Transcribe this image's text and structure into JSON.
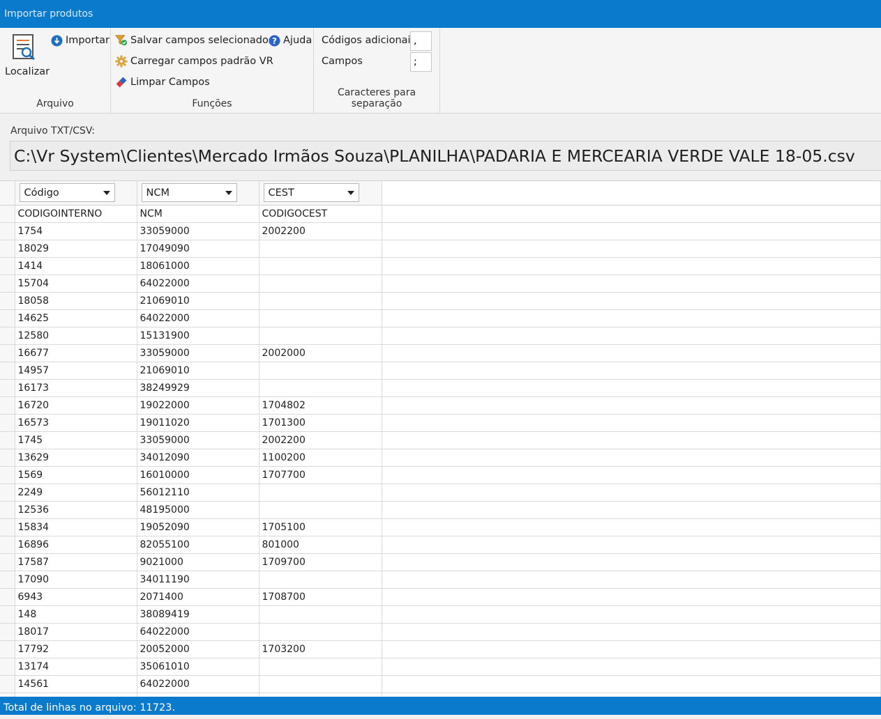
{
  "window": {
    "title": "Importar produtos"
  },
  "ribbon": {
    "arquivo": {
      "group_label": "Arquivo",
      "localizar_label": "Localizar",
      "importar_label": "Importar"
    },
    "funcoes": {
      "group_label": "Funções",
      "salvar_label": "Salvar campos selecionados",
      "ajuda_label": "Ajuda",
      "carregar_label": "Carregar campos padrão VR",
      "limpar_label": "Limpar Campos"
    },
    "separadores": {
      "group_label": "Caracteres para separação",
      "codigos_label": "Códigos adicionais",
      "codigos_value": ",",
      "campos_label": "Campos",
      "campos_value": ";"
    }
  },
  "file": {
    "label": "Arquivo TXT/CSV:",
    "path": "C:\\Vr System\\Clientes\\Mercado Irmãos Souza\\PLANILHA\\PADARIA E MERCEARIA VERDE VALE 18-05.csv"
  },
  "grid": {
    "field_selectors": [
      "Código",
      "NCM",
      "CEST"
    ],
    "rows": [
      [
        "CODIGOINTERNO",
        "NCM",
        "CODIGOCEST"
      ],
      [
        "1754",
        "33059000",
        "2002200"
      ],
      [
        "18029",
        "17049090",
        ""
      ],
      [
        "1414",
        "18061000",
        ""
      ],
      [
        "15704",
        "64022000",
        ""
      ],
      [
        "18058",
        "21069010",
        ""
      ],
      [
        "14625",
        "64022000",
        ""
      ],
      [
        "12580",
        "15131900",
        ""
      ],
      [
        "16677",
        "33059000",
        "2002000"
      ],
      [
        "14957",
        "21069010",
        ""
      ],
      [
        "16173",
        "38249929",
        ""
      ],
      [
        "16720",
        "19022000",
        "1704802"
      ],
      [
        "16573",
        "19011020",
        "1701300"
      ],
      [
        "1745",
        "33059000",
        "2002200"
      ],
      [
        "13629",
        "34012090",
        "1100200"
      ],
      [
        "1569",
        "16010000",
        "1707700"
      ],
      [
        "2249",
        "56012110",
        ""
      ],
      [
        "12536",
        "48195000",
        ""
      ],
      [
        "15834",
        "19052090",
        "1705100"
      ],
      [
        "16896",
        "82055100",
        "801000"
      ],
      [
        "17587",
        "9021000",
        "1709700"
      ],
      [
        "17090",
        "34011190",
        ""
      ],
      [
        "6943",
        "2071400",
        "1708700"
      ],
      [
        "148",
        "38089419",
        ""
      ],
      [
        "18017",
        "64022000",
        ""
      ],
      [
        "17792",
        "20052000",
        "1703200"
      ],
      [
        "13174",
        "35061010",
        ""
      ],
      [
        "14561",
        "64022000",
        ""
      ],
      [
        "",
        "",
        ""
      ]
    ]
  },
  "status": {
    "text": "Total de linhas no arquivo: 11723."
  }
}
